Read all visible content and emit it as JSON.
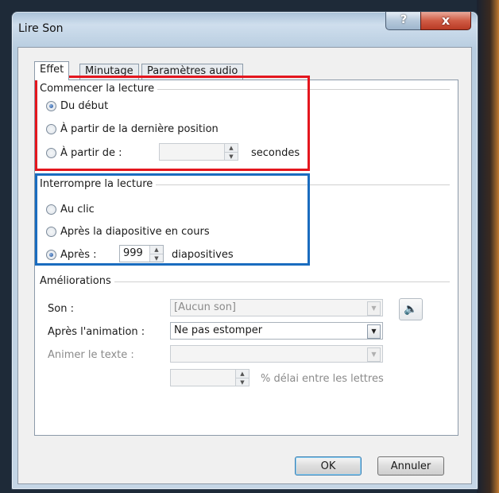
{
  "window": {
    "title": "Lire Son",
    "help_label": "?",
    "close_label": "x"
  },
  "tabs": [
    {
      "label": "Effet",
      "active": true
    },
    {
      "label": "Minutage",
      "active": false
    },
    {
      "label": "Paramètres audio",
      "active": false
    }
  ],
  "start_group": {
    "title": "Commencer la lecture",
    "options": [
      {
        "label": "Du début",
        "selected": true
      },
      {
        "label": "À partir de la dernière position",
        "selected": false
      },
      {
        "label": "À partir de :",
        "selected": false
      }
    ],
    "seconds_value": "",
    "seconds_unit": "secondes"
  },
  "stop_group": {
    "title": "Interrompre la lecture",
    "options": [
      {
        "label": "Au clic",
        "selected": false
      },
      {
        "label": "Après la diapositive en cours",
        "selected": false
      },
      {
        "label": "Après :",
        "selected": true
      }
    ],
    "slides_value": "999",
    "slides_unit": "diapositives"
  },
  "enhancements": {
    "title": "Améliorations",
    "sound_label": "Son :",
    "sound_value": "[Aucun son]",
    "after_anim_label": "Après l'animation :",
    "after_anim_value": "Ne pas estomper",
    "animate_text_label": "Animer le texte :",
    "animate_text_value": "",
    "delay_value": "",
    "delay_unit": "% délai entre les lettres"
  },
  "buttons": {
    "ok": "OK",
    "cancel": "Annuler"
  },
  "highlights": {
    "red": "#e4161e",
    "blue": "#1a6cbf"
  }
}
